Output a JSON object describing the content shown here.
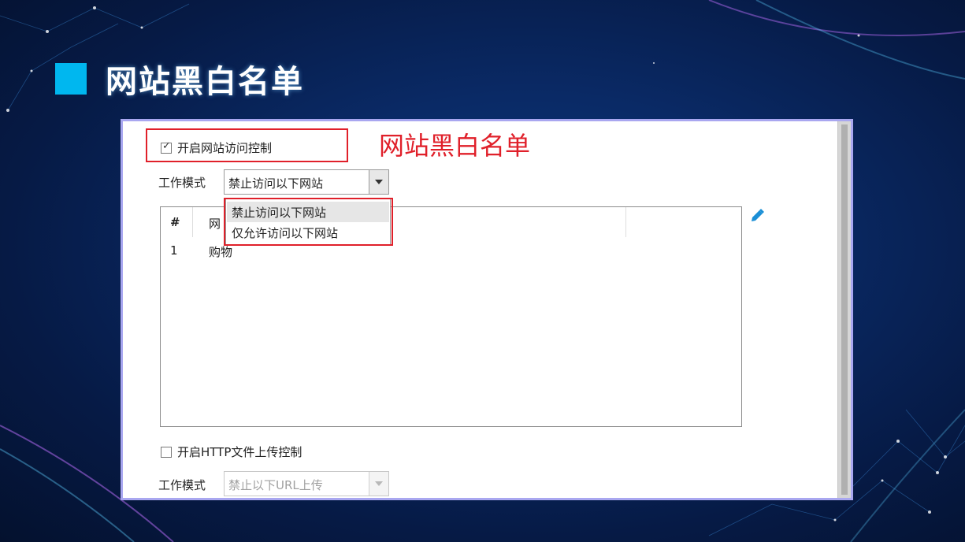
{
  "slide": {
    "title": "网站黑白名单",
    "accent_color": "#00b7ef"
  },
  "annotation": {
    "label": "网站黑白名单",
    "color": "#e0202a"
  },
  "website_control": {
    "checkbox_label": "开启网站访问控制",
    "checked": true,
    "mode_label": "工作模式",
    "mode_value": "禁止访问以下网站",
    "dropdown_options": [
      "禁止访问以下网站",
      "仅允许访问以下网站"
    ],
    "selected_option_index": 0
  },
  "table": {
    "columns": [
      "#",
      "网"
    ],
    "rows": [
      {
        "index": "1",
        "name": "购物"
      }
    ],
    "edit_icon": "pencil-icon"
  },
  "http_upload_control": {
    "checkbox_label": "开启HTTP文件上传控制",
    "checked": false,
    "mode_label": "工作模式",
    "mode_value": "禁止以下URL上传",
    "disabled": true
  }
}
